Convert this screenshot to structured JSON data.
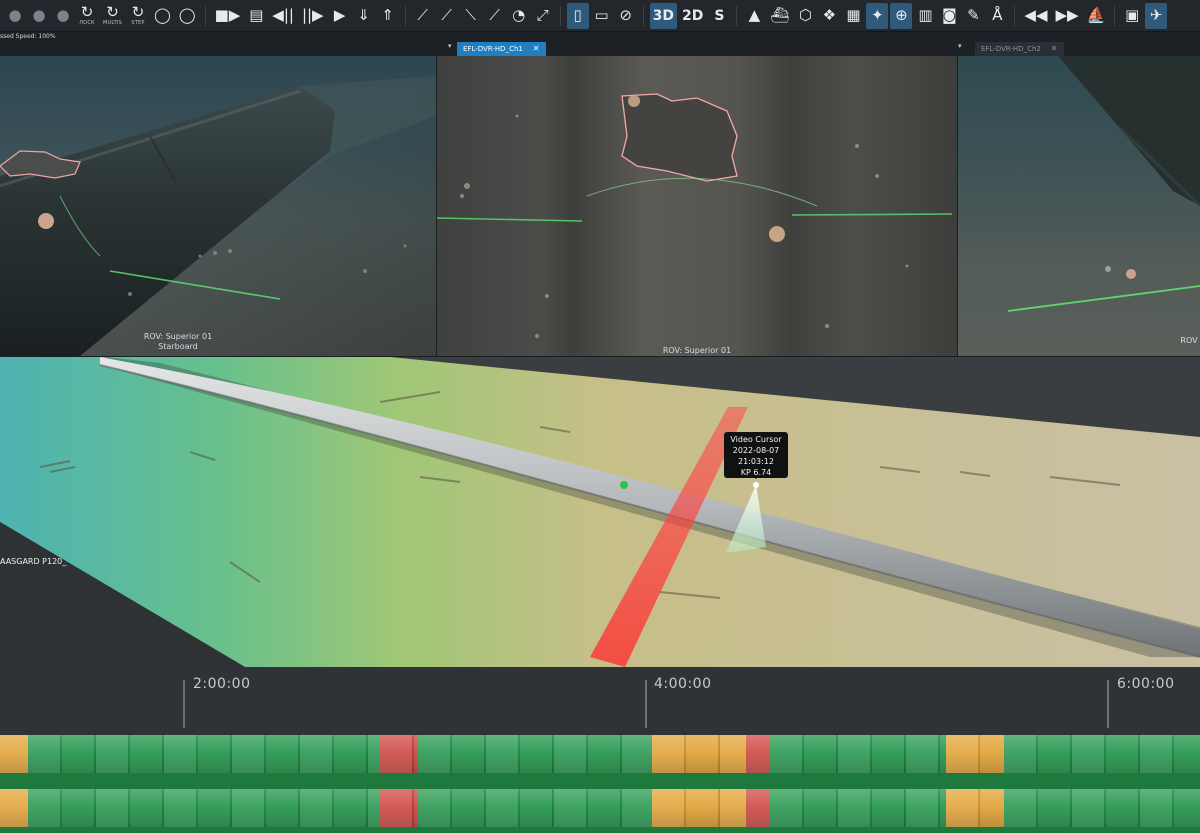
{
  "toolbar": {
    "groups": [
      [
        {
          "name": "record-dot-icon",
          "glyph": "●",
          "dim": true
        },
        {
          "name": "record-small-icon",
          "glyph": "●",
          "dim": true
        },
        {
          "name": "record-tiny-icon",
          "glyph": "●",
          "dim": true
        },
        {
          "name": "refresh-icon",
          "glyph": "↻",
          "mini": "ЛОСК"
        },
        {
          "name": "refresh-multi-icon",
          "glyph": "↻",
          "mini": "MULTIS"
        },
        {
          "name": "refresh-step-icon",
          "glyph": "↻",
          "mini": "STEP"
        },
        {
          "name": "ring-icon",
          "glyph": "◯"
        },
        {
          "name": "ring-alt-icon",
          "glyph": "◯"
        }
      ],
      [
        {
          "name": "video-camera-icon",
          "glyph": "■▶"
        },
        {
          "name": "clapper-icon",
          "glyph": "▤"
        },
        {
          "name": "step-back-icon",
          "glyph": "◀||"
        },
        {
          "name": "step-forward-icon",
          "glyph": "||▶"
        },
        {
          "name": "play-icon",
          "glyph": "▶"
        },
        {
          "name": "download-icon",
          "glyph": "⇓"
        },
        {
          "name": "upload-icon",
          "glyph": "⇑"
        }
      ],
      [
        {
          "name": "measure-point-icon",
          "glyph": "⟋"
        },
        {
          "name": "measure-line-icon",
          "glyph": "⟋"
        },
        {
          "name": "measure-arrow-icon",
          "glyph": "⟍"
        },
        {
          "name": "measure-draw-icon",
          "glyph": "⟋"
        },
        {
          "name": "clock-icon",
          "glyph": "◔"
        },
        {
          "name": "fullscreen-icon",
          "glyph": "⤢"
        }
      ],
      [
        {
          "name": "document-icon",
          "glyph": "▯",
          "active": true
        },
        {
          "name": "comment-icon",
          "glyph": "▭"
        },
        {
          "name": "link-icon",
          "glyph": "⊘"
        }
      ],
      [
        {
          "name": "view-3d-button",
          "glyph": "3D",
          "text": true,
          "active": true
        },
        {
          "name": "view-2d-button",
          "glyph": "2D",
          "text": true
        },
        {
          "name": "view-s-button",
          "glyph": "S",
          "text": true
        }
      ],
      [
        {
          "name": "north-arrow-icon",
          "glyph": "▲"
        },
        {
          "name": "vessel-icon",
          "glyph": "⛴"
        },
        {
          "name": "cube-icon",
          "glyph": "⬡"
        },
        {
          "name": "sphere-dots-icon",
          "glyph": "❖"
        },
        {
          "name": "grid-icon",
          "glyph": "▦"
        },
        {
          "name": "africa-map-icon",
          "glyph": "✦",
          "active": true
        },
        {
          "name": "globe-icon",
          "glyph": "⊕",
          "active": true
        },
        {
          "name": "map-icon",
          "glyph": "▥"
        },
        {
          "name": "camera-icon",
          "glyph": "◙"
        },
        {
          "name": "ruler-icon",
          "glyph": "✎"
        },
        {
          "name": "compass-icon",
          "glyph": "Å"
        }
      ],
      [
        {
          "name": "rewind-icon",
          "glyph": "◀◀"
        },
        {
          "name": "fast-forward-icon",
          "glyph": "▶▶"
        },
        {
          "name": "ship-icon",
          "glyph": "⛵"
        }
      ],
      [
        {
          "name": "save-icon",
          "glyph": "▣"
        },
        {
          "name": "airplane-icon",
          "glyph": "✈",
          "active": true
        }
      ]
    ]
  },
  "tabstrip": {
    "speed_text": "ssed Speed: 100%",
    "tabs": [
      {
        "label": "EFL-DVR-HD_Ch1",
        "close": "✕",
        "active": true
      },
      {
        "label": "EFL-DVR-HD_Ch2",
        "close": "✕",
        "active": false
      }
    ],
    "dropdown": "▾"
  },
  "panes": {
    "left": {
      "line1": "ROV: Superior 01",
      "line2": "Starboard"
    },
    "middle": {
      "line1": "ROV: Superior 01"
    },
    "right": {
      "line1": "ROV"
    }
  },
  "view3d": {
    "model_label": "AASGARD P120_",
    "cursor": {
      "title": "Video Cursor",
      "date": "2022-08-07",
      "time": "21:03:12",
      "kp": "KP 6.74"
    }
  },
  "timeline": {
    "ticks": [
      "2:00:00",
      "4:00:00",
      "6:00:00"
    ]
  },
  "colors": {
    "accent": "#1f7fc2",
    "strip_green": "#2a9a52",
    "strip_orange": "#e3a63b",
    "strip_red": "#d04a44",
    "cut_plane": "#ff3b3b"
  },
  "strips": {
    "segments": [
      {
        "type": "orange",
        "from": 0,
        "to": 28
      },
      {
        "type": "green",
        "from": 28,
        "to": 380
      },
      {
        "type": "red",
        "from": 380,
        "to": 418
      },
      {
        "type": "green",
        "from": 418,
        "to": 652
      },
      {
        "type": "orange",
        "from": 652,
        "to": 746
      },
      {
        "type": "red",
        "from": 746,
        "to": 770
      },
      {
        "type": "green",
        "from": 770,
        "to": 946
      },
      {
        "type": "orange",
        "from": 946,
        "to": 1004
      },
      {
        "type": "green",
        "from": 1004,
        "to": 1200
      }
    ]
  }
}
